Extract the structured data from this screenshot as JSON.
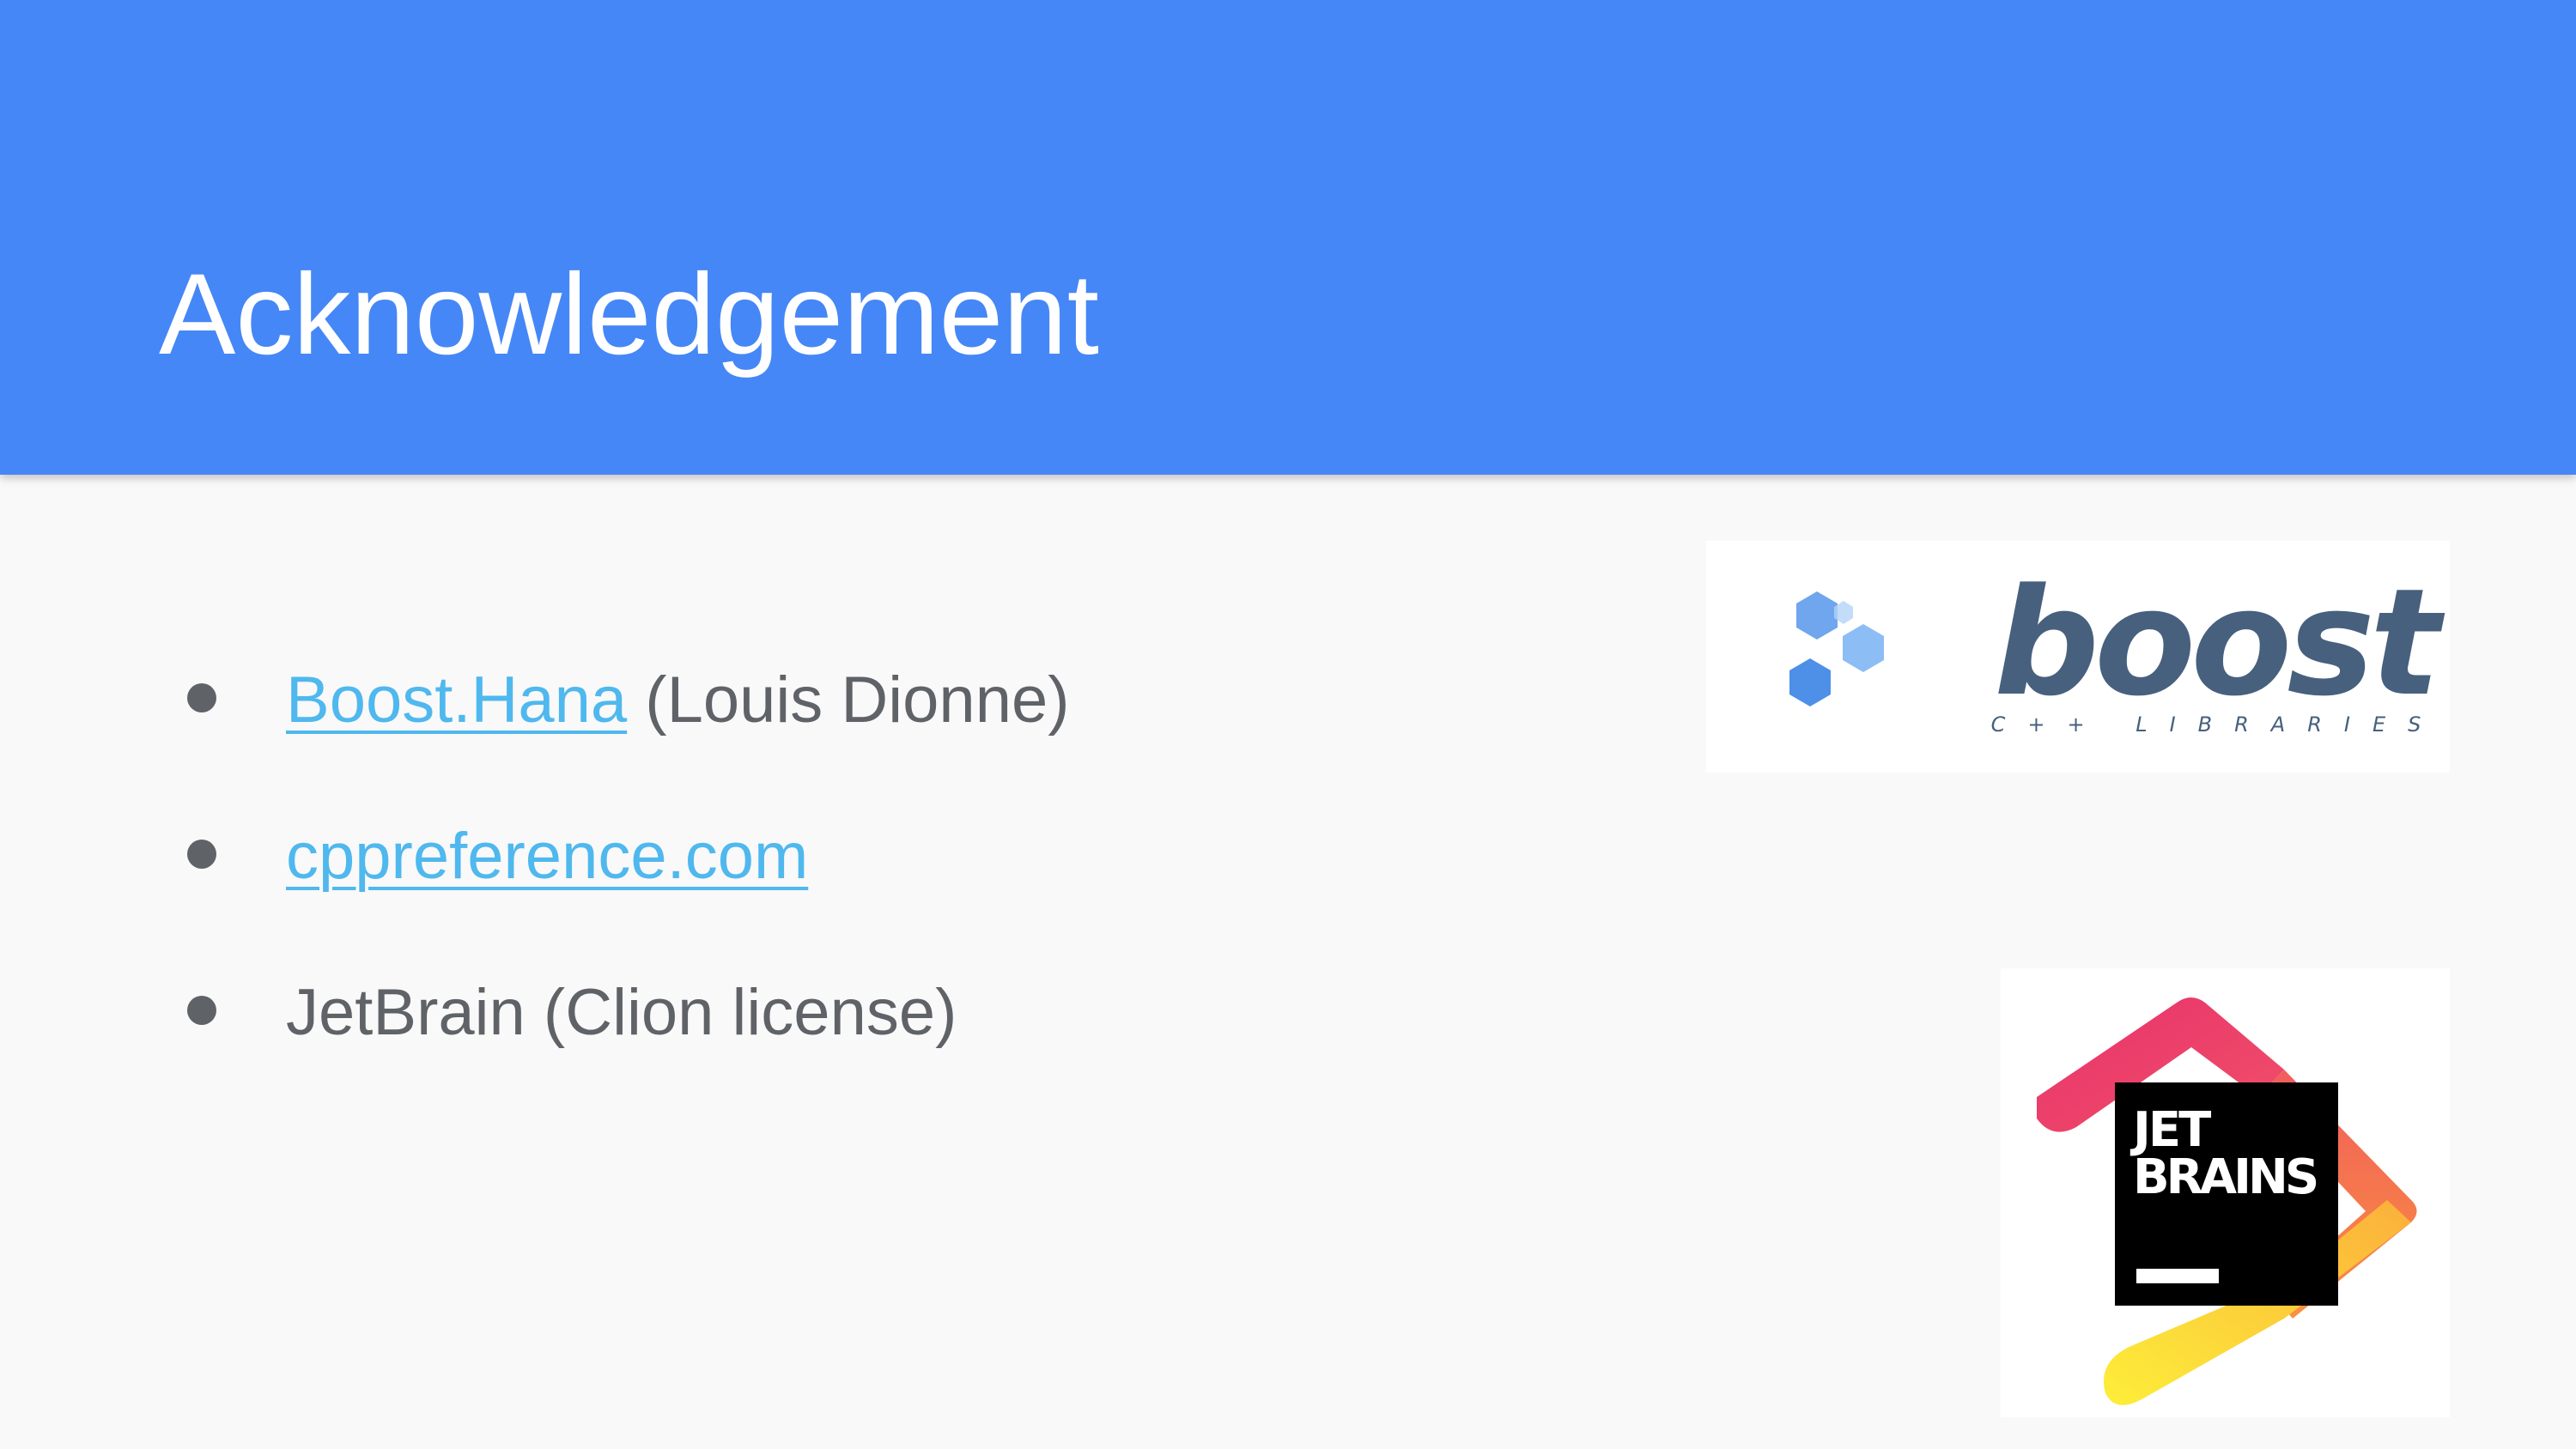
{
  "slide": {
    "title": "Acknowledgement"
  },
  "bullets": [
    {
      "link_text": "Boost.Hana",
      "text": " (Louis Dionne)"
    },
    {
      "link_text": "cppreference.com",
      "text": ""
    },
    {
      "link_text": "",
      "text": "JetBrain (Clion license)"
    }
  ],
  "logos": {
    "boost": {
      "wordmark": "boost",
      "tagline": "C++ LIBRARIES",
      "icon": "hexagon-cluster-icon"
    },
    "jetbrains": {
      "line1": "JET",
      "line2": "BRAINS",
      "icon": "jetbrains-logo-icon"
    }
  },
  "colors": {
    "header": "#4587f6",
    "background": "#f9f9f9",
    "link": "#4fb8ee",
    "text": "#5f6368",
    "boost_text": "#47607e",
    "boost_hex": "#4e8fe8"
  }
}
